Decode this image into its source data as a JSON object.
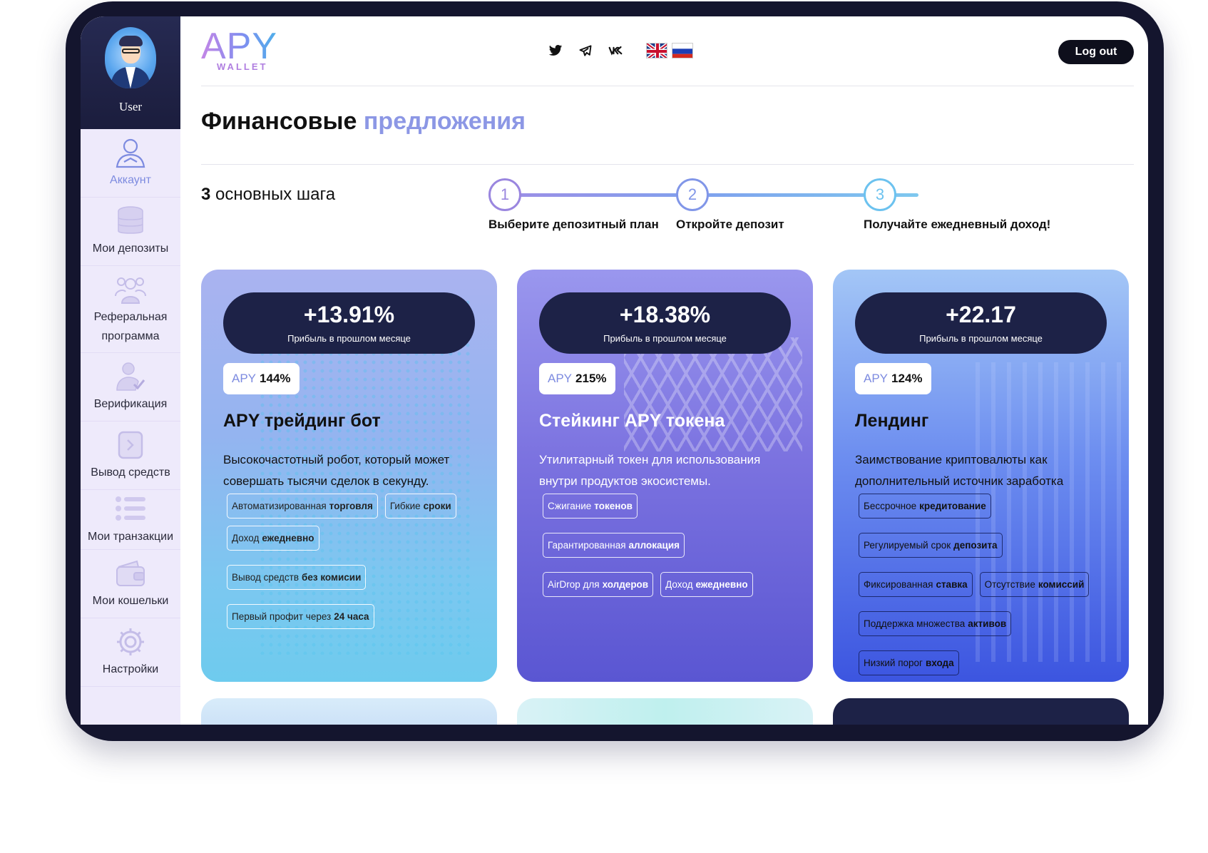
{
  "sidebar": {
    "user_name": "User",
    "items": [
      {
        "label": "Аккаунт",
        "icon": "user-icon"
      },
      {
        "label": "Мои депозиты",
        "icon": "database-icon"
      },
      {
        "label": "Реферальная программа",
        "icon": "referral-icon"
      },
      {
        "label": "Верификация",
        "icon": "verification-icon"
      },
      {
        "label": "Вывод средств",
        "icon": "withdraw-icon"
      },
      {
        "label": "Мои транзакции",
        "icon": "list-icon"
      },
      {
        "label": "Мои кошельки",
        "icon": "wallet-icon"
      },
      {
        "label": "Настройки",
        "icon": "gear-icon"
      }
    ],
    "active_color": "#7d8be0"
  },
  "header": {
    "logo_main": "APY",
    "logo_sub": "WALLET",
    "socials": [
      "twitter-icon",
      "telegram-icon",
      "vk-icon"
    ],
    "languages": [
      "en",
      "ru"
    ],
    "logout_label": "Log out"
  },
  "page": {
    "title_main": "Финансовые",
    "title_accent": "предложения",
    "steps_count": "3",
    "steps_heading": "основных шага",
    "steps": [
      {
        "num": "1",
        "label": "Выберите депозитный план",
        "color": "#9a86df"
      },
      {
        "num": "2",
        "label": "Откройте депозит",
        "color": "#8196e8"
      },
      {
        "num": "3",
        "label": "Получайте ежедневный доход!",
        "color": "#6cc2ef"
      }
    ]
  },
  "cards": [
    {
      "profit": "+13.91%",
      "profit_caption": "Прибыль в прошлом месяце",
      "apy_key": "APY",
      "apy_value": "144%",
      "title": "APY трейдинг бот",
      "description": "Высокочастотный робот, который может совершать тысячи сделок в секунду.",
      "tags": [
        {
          "text": "Автоматизированная",
          "bold": "торговля"
        },
        {
          "text": "Гибкие",
          "bold": "сроки"
        },
        {
          "text": "Доход",
          "bold": "ежедневно"
        },
        {
          "text": "Вывод средств",
          "bold": "без комисии"
        },
        {
          "text": "Первый профит через",
          "bold": "24 часа"
        }
      ]
    },
    {
      "profit": "+18.38%",
      "profit_caption": "Прибыль в прошлом месяце",
      "apy_key": "APY",
      "apy_value": "215%",
      "title": "Стейкинг APY токена",
      "description": "Утилитарный токен для использования внутри продуктов экосистемы.",
      "tags": [
        {
          "text": "Сжигание",
          "bold": "токенов"
        },
        {
          "text": "Гарантированная",
          "bold": "аллокация"
        },
        {
          "text": "AirDrop для",
          "bold": "холдеров"
        },
        {
          "text": "Доход",
          "bold": "ежедневно"
        }
      ]
    },
    {
      "profit": "+22.17",
      "profit_caption": "Прибыль в прошлом месяце",
      "apy_key": "APY",
      "apy_value": "124%",
      "title": "Лендинг",
      "description": "Заимствование криптовалюты как дополнительный источник заработка",
      "tags": [
        {
          "text": "Бессрочное",
          "bold": "кредитование"
        },
        {
          "text": "Регулируемый срок",
          "bold": "депозита"
        },
        {
          "text": "Фиксированная",
          "bold": "ставка"
        },
        {
          "text": "Отсутствие",
          "bold": "комиссий"
        },
        {
          "text": "Поддержка множества",
          "bold": "активов"
        },
        {
          "text": "Низкий порог",
          "bold": "входа"
        }
      ]
    }
  ]
}
